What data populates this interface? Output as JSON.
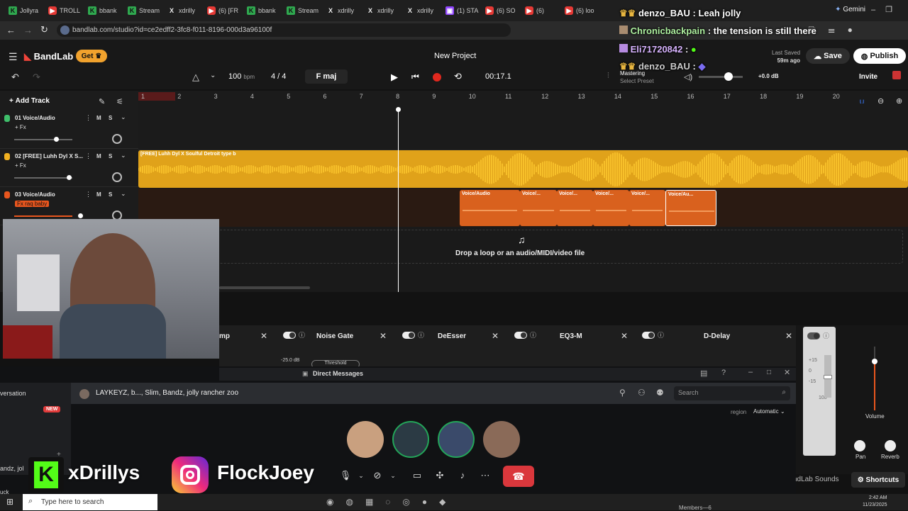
{
  "browser": {
    "tabs": [
      {
        "icon": "k",
        "label": "Jollyra"
      },
      {
        "icon": "yt",
        "label": "TROLL"
      },
      {
        "icon": "k",
        "label": "bbank"
      },
      {
        "icon": "k",
        "label": "Stream"
      },
      {
        "icon": "x",
        "label": "xdrilly"
      },
      {
        "icon": "yt",
        "label": "(6) [FR"
      },
      {
        "icon": "k",
        "label": "bbank"
      },
      {
        "icon": "k",
        "label": "Stream"
      },
      {
        "icon": "x",
        "label": "xdrilly"
      },
      {
        "icon": "x",
        "label": "xdrilly"
      },
      {
        "icon": "x",
        "label": "xdrilly"
      },
      {
        "icon": "tw",
        "label": "(1) STA"
      },
      {
        "icon": "yt",
        "label": "(6) SO"
      },
      {
        "icon": "yt",
        "label": "(6)"
      },
      {
        "icon": "yt",
        "label": "(6) loo"
      }
    ],
    "gemini_label": "Gemini",
    "url": "bandlab.com/studio?id=ce2edff2-3fc8-f011-8196-000d3a96100f"
  },
  "bandlab": {
    "logo": "BandLab",
    "get_label": "Get",
    "project_title": "New Project",
    "last_saved_label": "Last Saved",
    "last_saved_value": "59m ago",
    "save_label": "Save",
    "publish_label": "Publish",
    "invite_label": "Invite",
    "bpm_value": "100",
    "bpm_unit": "bpm",
    "time_sig": "4 / 4",
    "key": "F maj",
    "time_display": "00:17.1",
    "mastering_label": "Mastering",
    "mastering_preset": "Select Preset",
    "volume_db": "+0.0 dB",
    "add_track": "Add Track",
    "ruler": [
      "1",
      "2",
      "3",
      "4",
      "5",
      "6",
      "7",
      "8",
      "9",
      "10",
      "11",
      "12",
      "13",
      "14",
      "15",
      "16",
      "17",
      "18",
      "19",
      "20"
    ],
    "tracks": [
      {
        "name": "01  Voice/Audio",
        "fx": "+ Fx",
        "color": "#3fbf6b"
      },
      {
        "name": "02  [FREE] Luhh Dyl X S...",
        "fx": "+ Fx",
        "color": "#f0b020"
      },
      {
        "name": "03  Voice/Audio",
        "fx": "Fx raq baby",
        "color": "#e8561e"
      }
    ],
    "mute_label": "M",
    "solo_label": "S",
    "clip_beat": "[FREE] Luhh Dyl X Soulful Detroit type b",
    "clips_vocal": [
      "Voice/Audio",
      "Voice/...",
      "Voice/...",
      "Voice/...",
      "Voice/...",
      "Voice/Au..."
    ],
    "drop_hint": "Drop a loop or an audio/MIDI/video file",
    "effects": [
      {
        "name": "mp"
      },
      {
        "name": "Noise Gate"
      },
      {
        "name": "DeEsser"
      },
      {
        "name": "EQ3-M"
      },
      {
        "name": "D-Delay"
      }
    ],
    "threshold_value": "-25.0 dB",
    "threshold_label": "Threshold",
    "meter_ticks": [
      "+15",
      "0",
      "-15",
      "100"
    ],
    "volume_label": "Volume",
    "pan_label": "Pan",
    "reverb_label": "Reverb",
    "sounds_label": "ndLab Sounds",
    "shortcuts_label": "Shortcuts"
  },
  "discord": {
    "window_title": "Direct Messages",
    "conversation_label": "versation",
    "new_badge": "NEW",
    "group_name": "LAYKEYZ, b..., Slim, Bandz, jolly rancher zoo",
    "search_placeholder": "Search",
    "region_label": "region",
    "region_value": "Automatic",
    "side_names": [
      "andz, jol",
      "uck"
    ],
    "members_label": "Members—6"
  },
  "overlay": {
    "handle_kick": "xDrillys",
    "handle_ig": "FlockJoey",
    "chat": [
      {
        "user": "denzo_BAU",
        "text": "Leah jolly"
      },
      {
        "user": "Chronicbackpain",
        "text": "the tension is still there"
      },
      {
        "user": "Eli71720842",
        "text": ""
      },
      {
        "user": "denzo_BAU",
        "text": ""
      }
    ]
  },
  "taskbar": {
    "search_placeholder": "Type here to search",
    "time": "2:42 AM",
    "date": "11/23/2025"
  }
}
